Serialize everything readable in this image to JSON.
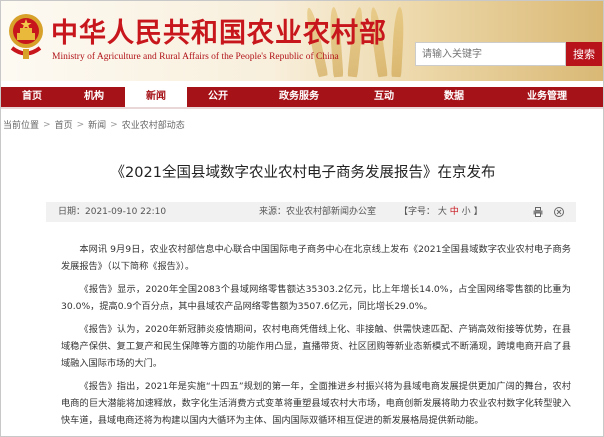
{
  "header": {
    "site_title": "中华人民共和国农业农村部",
    "site_subtitle": "Ministry of Agriculture and Rural Affairs of the People's Republic of China",
    "search_placeholder": "请输入关键字",
    "search_button": "搜索"
  },
  "nav": {
    "items": [
      {
        "label": "首页"
      },
      {
        "label": "机构"
      },
      {
        "label": "新闻",
        "active": true
      },
      {
        "label": "公开"
      },
      {
        "label": "政务服务"
      },
      {
        "label": "互动"
      },
      {
        "label": "数据"
      },
      {
        "label": "业务管理"
      }
    ]
  },
  "breadcrumb": {
    "current": "当前位置",
    "items": [
      "首页",
      "新闻",
      "农业农村部动态"
    ],
    "separator": ">"
  },
  "article": {
    "title": "《2021全国县域数字农业农村电子商务发展报告》在京发布",
    "date": "日期：2021-09-10 22:10",
    "source": "来源：农业农村部新闻办公室",
    "font_prefix": "【字号：",
    "font_large": "大",
    "font_medium": "中",
    "font_small": "小",
    "font_suffix": "】",
    "paragraphs": [
      "本网讯 9月9日，农业农村部信息中心联合中国国际电子商务中心在北京线上发布《2021全国县域数字农业农村电子商务发展报告》（以下简称《报告》）。",
      "《报告》显示，2020年全国2083个县域网络零售额达35303.2亿元，比上年增长14.0%，占全国网络零售额的比重为30.0%，提高0.9个百分点，其中县域农产品网络零售额为3507.6亿元，同比增长29.0%。",
      "《报告》认为，2020年新冠肺炎疫情期间，农村电商凭借线上化、非接触、供需快速匹配、产销高效衔接等优势，在县域稳产保供、复工复产和民生保障等方面的功能作用凸显，直播带货、社区团购等新业态新模式不断涌现，跨境电商开启了县域融入国际市场的大门。",
      "《报告》指出，2021年是实施“十四五”规划的第一年，全面推进乡村振兴将为县域电商发展提供更加广阔的舞台，农村电商的巨大潜能将加速释放，数字化生活消费方式变革将重塑县域农村大市场，电商创新发展将助力农业农村数字化转型驶入快车道，县域电商还将为构建以国内大循环为主体、国内国际双循环相互促进的新发展格局提供新动能。"
    ]
  },
  "colors": {
    "brand_red": "#c8161d",
    "nav_red": "#a51218",
    "meta_bg": "#f1f1f1"
  },
  "icons": [
    "national-emblem-icon",
    "home-icon",
    "print-icon",
    "close-icon"
  ]
}
